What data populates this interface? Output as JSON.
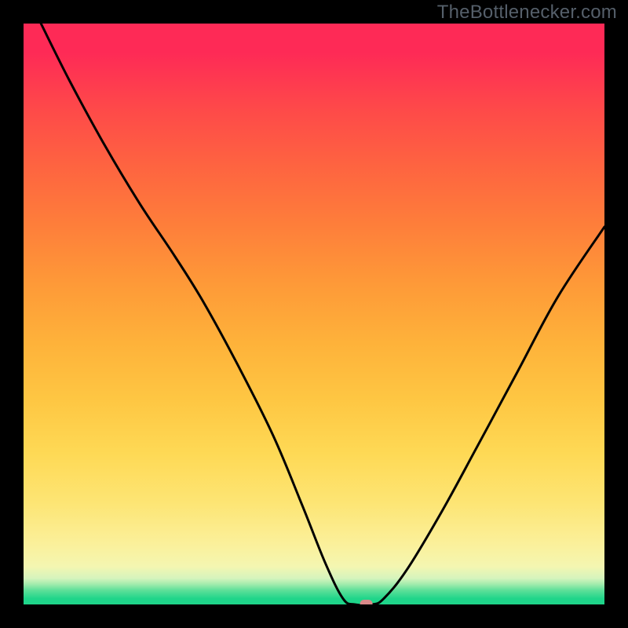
{
  "watermark": "TheBottlenecker.com",
  "chart_data": {
    "type": "line",
    "title": "",
    "xlabel": "",
    "ylabel": "",
    "xlim": [
      0,
      100
    ],
    "ylim": [
      0,
      100
    ],
    "marker": {
      "x": 59,
      "y": 0,
      "color": "#d98989"
    },
    "series": [
      {
        "name": "curve",
        "points": [
          {
            "x": 3,
            "y": 100
          },
          {
            "x": 8,
            "y": 90
          },
          {
            "x": 14,
            "y": 79
          },
          {
            "x": 20,
            "y": 69
          },
          {
            "x": 26,
            "y": 60
          },
          {
            "x": 31,
            "y": 52
          },
          {
            "x": 37,
            "y": 41
          },
          {
            "x": 43,
            "y": 29
          },
          {
            "x": 48,
            "y": 17
          },
          {
            "x": 52,
            "y": 7
          },
          {
            "x": 55,
            "y": 1
          },
          {
            "x": 57,
            "y": 0
          },
          {
            "x": 60,
            "y": 0
          },
          {
            "x": 62,
            "y": 1
          },
          {
            "x": 66,
            "y": 6
          },
          {
            "x": 72,
            "y": 16
          },
          {
            "x": 78,
            "y": 27
          },
          {
            "x": 85,
            "y": 40
          },
          {
            "x": 92,
            "y": 53
          },
          {
            "x": 100,
            "y": 65
          }
        ]
      }
    ],
    "background_bands": [
      {
        "y0": 0.0,
        "y1": 2.0,
        "color": "#1fd58a"
      },
      {
        "y0": 2.0,
        "y1": 3.0,
        "color": "#61e09a"
      },
      {
        "y0": 3.0,
        "y1": 4.0,
        "color": "#a3ecad"
      },
      {
        "y0": 4.0,
        "y1": 5.0,
        "color": "#d5f4bd"
      },
      {
        "y0": 5.0,
        "y1": 8.0,
        "color": "#f4f6b1"
      },
      {
        "y0": 8.0,
        "y1": 13.0,
        "color": "#fbf09a"
      },
      {
        "y0": 13.0,
        "y1": 22.0,
        "color": "#fde574"
      },
      {
        "y0": 22.0,
        "y1": 30.0,
        "color": "#fed955"
      },
      {
        "y0": 30.0,
        "y1": 40.0,
        "color": "#fec743"
      },
      {
        "y0": 40.0,
        "y1": 50.0,
        "color": "#feb23a"
      },
      {
        "y0": 50.0,
        "y1": 60.0,
        "color": "#fe9a38"
      },
      {
        "y0": 60.0,
        "y1": 70.0,
        "color": "#fe7f3a"
      },
      {
        "y0": 70.0,
        "y1": 80.0,
        "color": "#fe6540"
      },
      {
        "y0": 80.0,
        "y1": 90.0,
        "color": "#fe4a49"
      },
      {
        "y0": 90.0,
        "y1": 100.0,
        "color": "#fe2a56"
      }
    ]
  }
}
